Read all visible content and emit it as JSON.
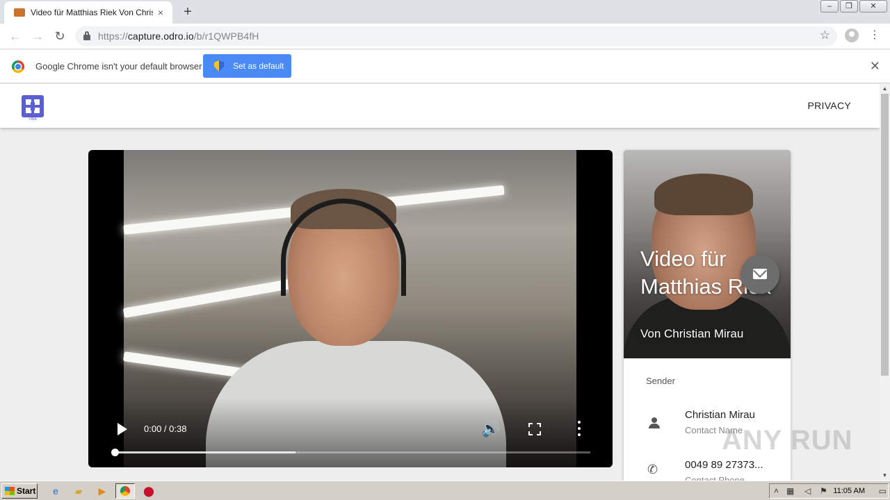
{
  "browser": {
    "tab": {
      "title": "Video für Matthias Riek Von Christian Mirau"
    },
    "address": {
      "host_prefix": "https://",
      "host": "capture.odro.io",
      "path": "/b/r1QWPB4fH"
    },
    "infobar": {
      "message": "Google Chrome isn't your default browser",
      "button_label": "Set as default"
    }
  },
  "site": {
    "logo_text": "VIRA",
    "nav": {
      "privacy_label": "PRIVACY"
    }
  },
  "video": {
    "current_time": "0:00",
    "duration": "0:38",
    "time_display": "0:00 / 0:38",
    "buffered_fraction": 0.38,
    "played_fraction": 0
  },
  "card": {
    "title": "Video für Matthias Riek",
    "subtitle": "Von Christian Mirau",
    "sender_heading": "Sender",
    "contact_name": "Christian Mirau",
    "contact_name_label": "Contact Name",
    "contact_phone": "0049 89 27373...",
    "contact_phone_label": "Contact Phone"
  },
  "watermark": "ANY RUN",
  "taskbar": {
    "start_label": "Start",
    "clock": "11:05 AM"
  },
  "icons": {
    "tab_close": "×",
    "new_tab": "+",
    "back": "←",
    "forward": "→",
    "reload": "↻",
    "star": "☆",
    "menu": "⋮",
    "infobar_close": "✕",
    "volume": "🔊",
    "phone": "✆",
    "window_minimize": "–",
    "window_restore": "❐",
    "window_close": "✕"
  }
}
